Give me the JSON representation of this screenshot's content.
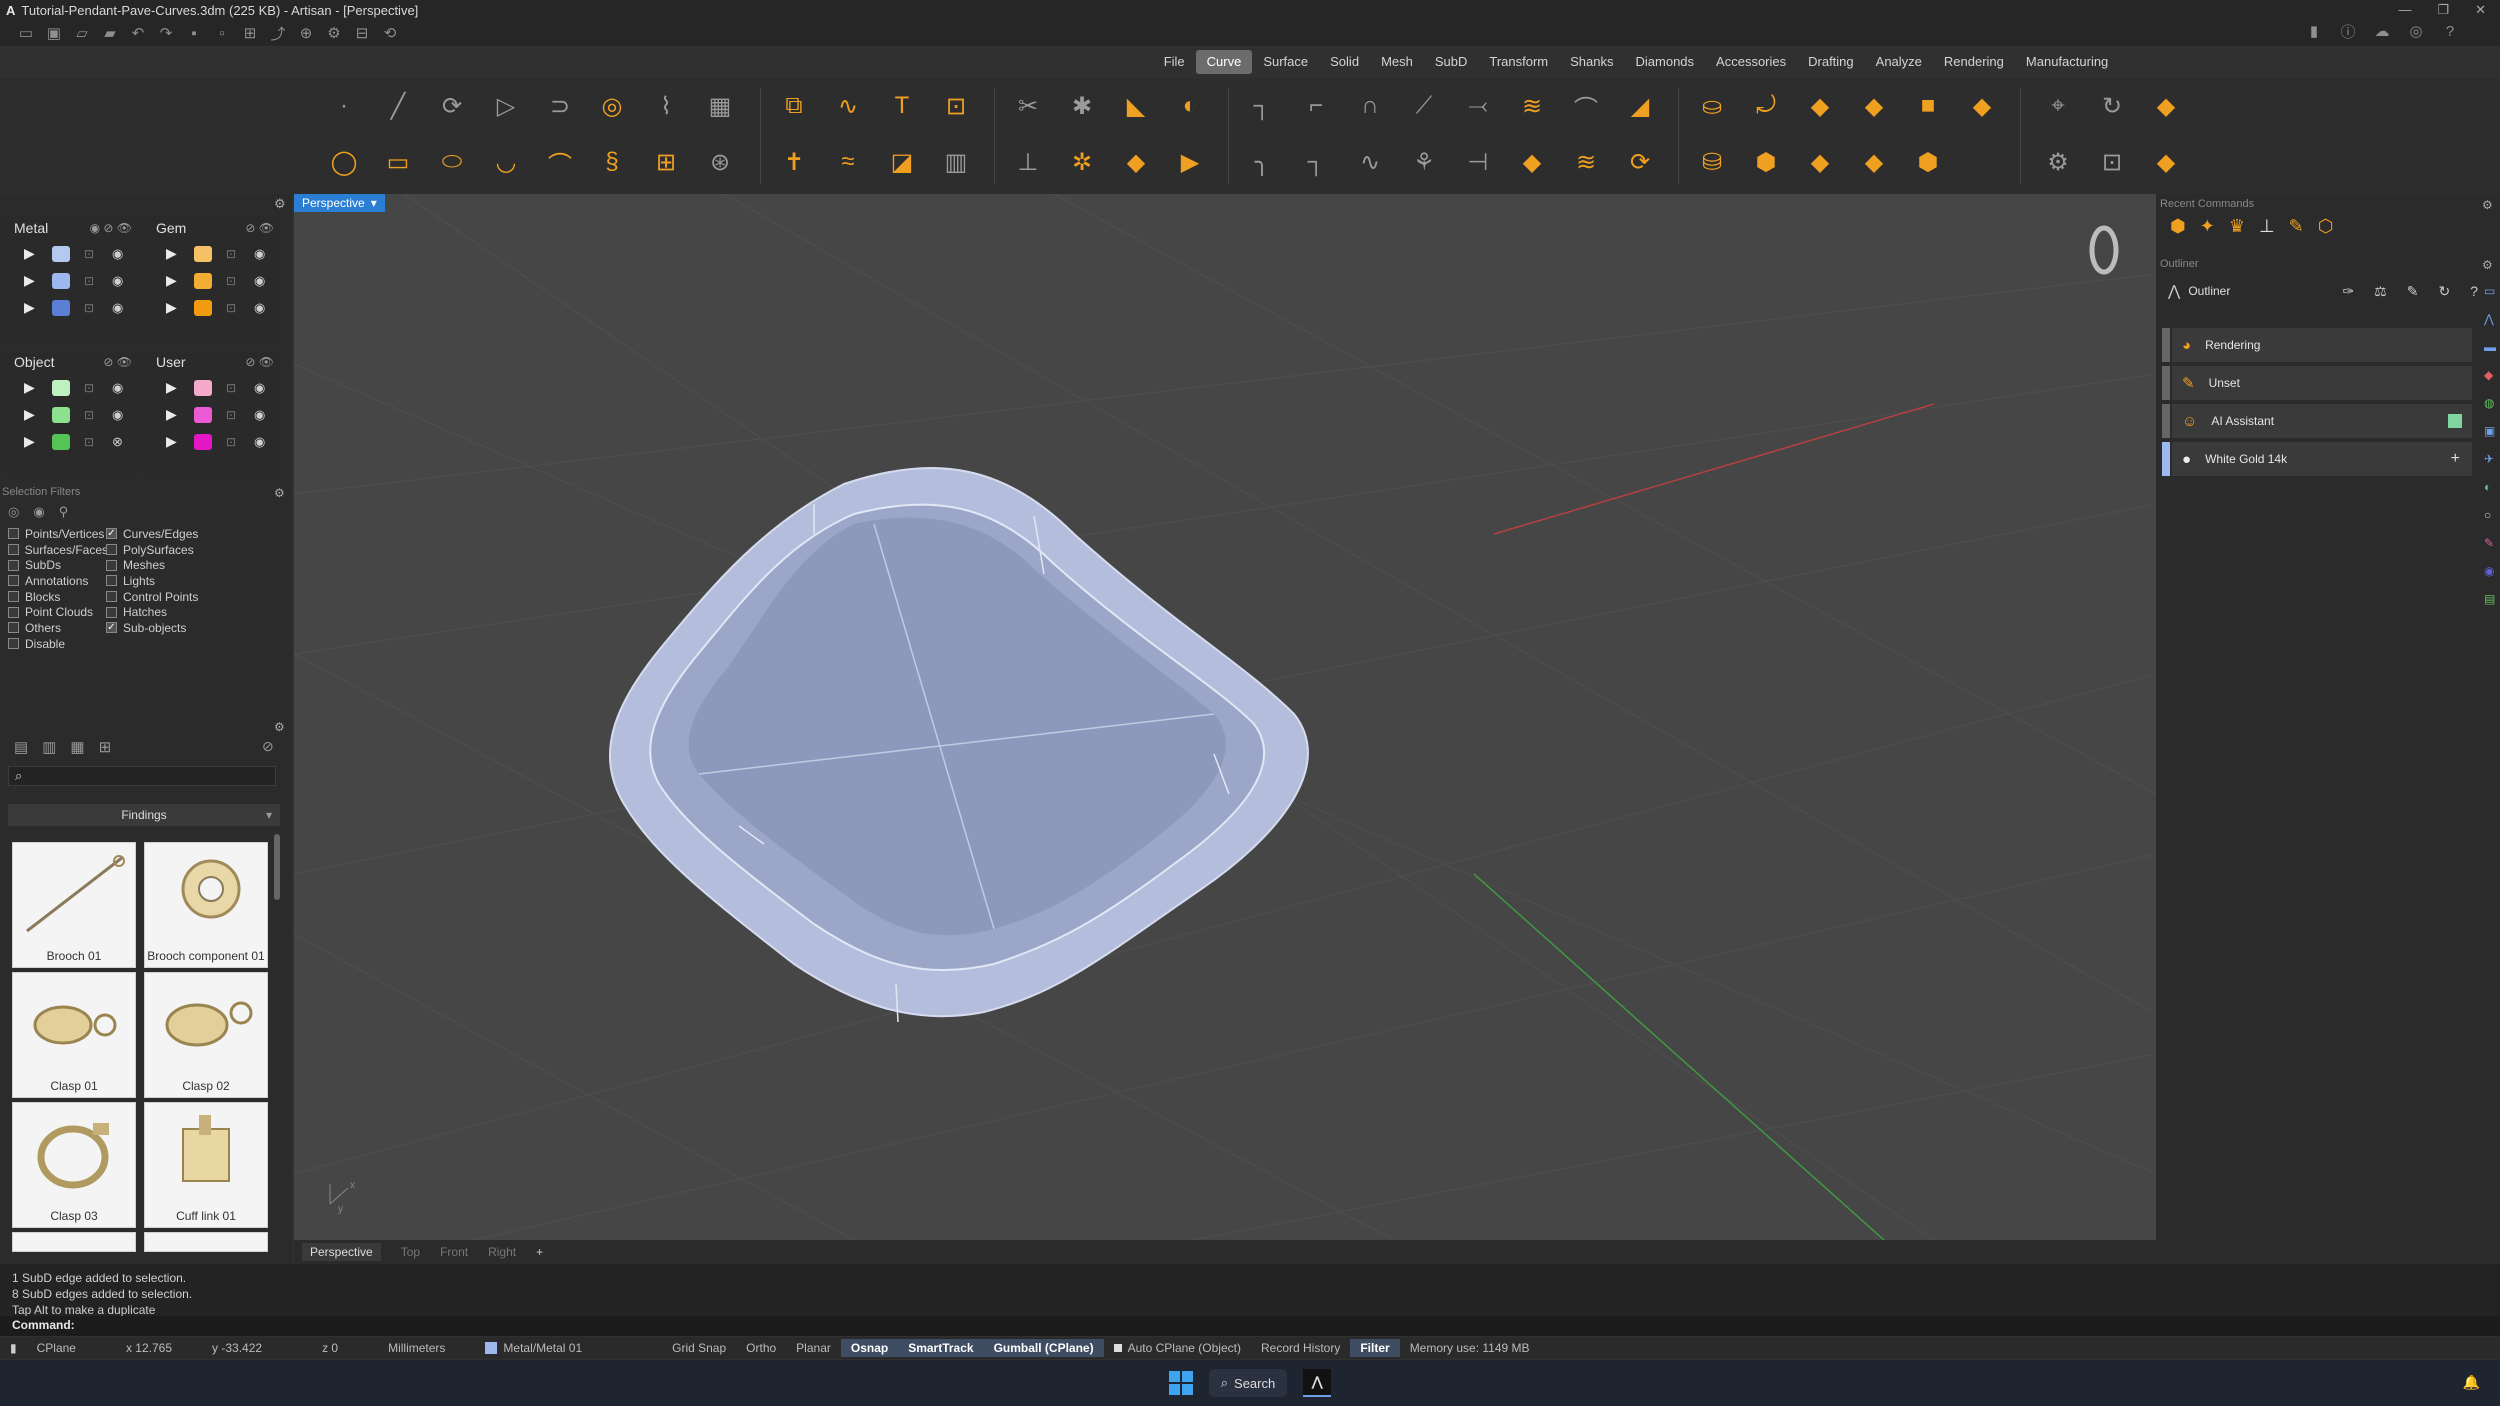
{
  "titlebar": {
    "logo": "A",
    "title": "Tutorial-Pendant-Pave-Curves.3dm (225 KB) - Artisan - [Perspective]"
  },
  "window_controls": [
    "—",
    "❐",
    "✕"
  ],
  "menu": [
    "File",
    "Curve",
    "Surface",
    "Solid",
    "Mesh",
    "SubD",
    "Transform",
    "Shanks",
    "Diamonds",
    "Accessories",
    "Drafting",
    "Analyze",
    "Rendering",
    "Manufacturing"
  ],
  "active_menu": "Curve",
  "layers": {
    "metal": {
      "title": "Metal",
      "colors": [
        "#b3c9f2",
        "#9db8ee",
        "#5a7fd4"
      ]
    },
    "gem": {
      "title": "Gem",
      "colors": [
        "#f6c064",
        "#f3ad34",
        "#f39c12"
      ]
    },
    "object": {
      "title": "Object",
      "colors": [
        "#bff0bf",
        "#8de08d",
        "#54c454"
      ]
    },
    "user": {
      "title": "User",
      "colors": [
        "#f5a9c9",
        "#ec5ad6",
        "#e516c6"
      ]
    }
  },
  "selection_filters": {
    "title": "Selection Filters",
    "left": [
      {
        "label": "Points/Vertices",
        "checked": false
      },
      {
        "label": "Surfaces/Faces",
        "checked": false
      },
      {
        "label": "SubDs",
        "checked": false
      },
      {
        "label": "Annotations",
        "checked": false
      },
      {
        "label": "Blocks",
        "checked": false
      },
      {
        "label": "Point Clouds",
        "checked": false
      },
      {
        "label": "Others",
        "checked": false
      },
      {
        "label": "Disable",
        "checked": false
      }
    ],
    "right": [
      {
        "label": "Curves/Edges",
        "checked": true
      },
      {
        "label": "PolySurfaces",
        "checked": false
      },
      {
        "label": "Meshes",
        "checked": false
      },
      {
        "label": "Lights",
        "checked": false
      },
      {
        "label": "Control Points",
        "checked": false
      },
      {
        "label": "Hatches",
        "checked": false
      },
      {
        "label": "Sub-objects",
        "checked": true
      }
    ]
  },
  "library": {
    "category": "Findings",
    "items": [
      "Brooch 01",
      "Brooch component 01",
      "Clasp 01",
      "Clasp 02",
      "Clasp 03",
      "Cuff link 01"
    ]
  },
  "viewport": {
    "label": "Perspective",
    "axis_labels": [
      "x",
      "y"
    ]
  },
  "view_tabs": [
    "Perspective",
    "Top",
    "Front",
    "Right",
    "+"
  ],
  "recent_commands": {
    "title": "Recent Commands"
  },
  "outliner": {
    "panel_title": "Outliner",
    "title": "Outliner",
    "items": [
      "Rendering",
      "Unset",
      "AI Assistant",
      "White Gold 14k"
    ]
  },
  "command_history": [
    "1 SubD edge added to selection.",
    "8 SubD edges added to selection.",
    "Tap Alt to make a duplicate"
  ],
  "command_prompt": "Command:",
  "status": {
    "cplane": "CPlane",
    "x": "x 12.765",
    "y": "y -33.422",
    "z": "z 0",
    "units": "Millimeters",
    "layer": "Metal/Metal 01",
    "grid_snap": "Grid Snap",
    "ortho": "Ortho",
    "planar": "Planar",
    "osnap": "Osnap",
    "smarttrack": "SmartTrack",
    "gumball": "Gumball (CPlane)",
    "auto_cplane": "Auto CPlane (Object)",
    "record_history": "Record History",
    "filter": "Filter",
    "memory": "Memory use: 1149 MB"
  },
  "taskbar": {
    "search": "Search"
  },
  "colors": {
    "viewport_bg": "#464646",
    "accent_blue": "#2a7fd4",
    "tool_gold": "#f0a020",
    "model_fill": "#aab4d4"
  }
}
